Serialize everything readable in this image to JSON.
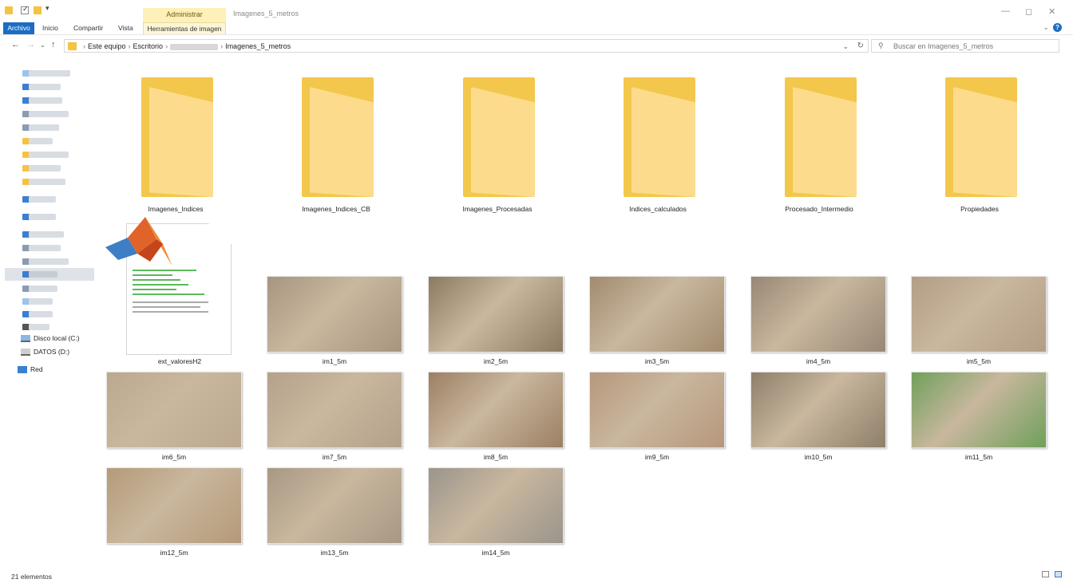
{
  "window": {
    "title": "Imagenes_5_metros",
    "manage_tab": "Administrar",
    "minimize": "—",
    "maximize": "◻",
    "close": "✕"
  },
  "ribbon": {
    "tabs": [
      "Archivo",
      "Inicio",
      "Compartir",
      "Vista",
      "Herramientas de imagen"
    ],
    "help": "?"
  },
  "address": {
    "crumbs": [
      "Este equipo",
      "Escritorio",
      "Imagenes_5_metros"
    ],
    "search_placeholder": "Buscar en Imagenes_5_metros"
  },
  "nav": {
    "drives": [
      "Disco local (C:)",
      "DATOS (D:)"
    ],
    "network": "Red"
  },
  "folders": [
    "Imagenes_Indices",
    "Imagenes_Indices_CB",
    "Imagenes_Procesadas",
    "Indices_calculados",
    "Procesado_Intermedio",
    "Propiedades"
  ],
  "script_file": "ext_valoresH2",
  "images": [
    {
      "name": "im1_5m",
      "color": "#a89580"
    },
    {
      "name": "im2_5m",
      "color": "#8c7a60"
    },
    {
      "name": "im3_5m",
      "color": "#a18b6e"
    },
    {
      "name": "im4_5m",
      "color": "#988775"
    },
    {
      "name": "im5_5m",
      "color": "#b39d85"
    },
    {
      "name": "im6_5m",
      "color": "#bba88f"
    },
    {
      "name": "im7_5m",
      "color": "#b5a18a"
    },
    {
      "name": "im8_5m",
      "color": "#9c8064"
    },
    {
      "name": "im9_5m",
      "color": "#b6977c"
    },
    {
      "name": "im10_5m",
      "color": "#8e7f6a"
    },
    {
      "name": "im11_5m",
      "color": "#6fa05a"
    },
    {
      "name": "im12_5m",
      "color": "#b59a78"
    },
    {
      "name": "im13_5m",
      "color": "#a89884"
    },
    {
      "name": "im14_5m",
      "color": "#9a958c"
    }
  ],
  "status": {
    "count": "21 elementos"
  }
}
